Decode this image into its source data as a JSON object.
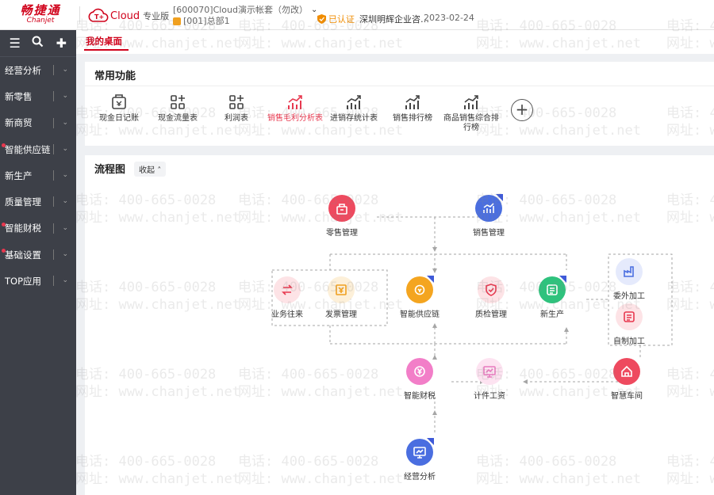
{
  "header": {
    "logo_cn": "畅捷通",
    "logo_en": "Chanjet",
    "product": "Cloud",
    "edition": "专业版",
    "account": "[600070]Cloud演示帐套（勿改）",
    "department": "[001]总部1",
    "certified_label": "已认证",
    "company": "深圳明辉企业咨…",
    "date": "2023-02-24"
  },
  "sidebar": {
    "tools": [
      "menu-icon",
      "search-icon",
      "plus-icon"
    ],
    "items": [
      {
        "label": "经营分析",
        "dot": false
      },
      {
        "label": "新零售",
        "dot": false
      },
      {
        "label": "新商贸",
        "dot": false
      },
      {
        "label": "智能供应链",
        "dot": true
      },
      {
        "label": "新生产",
        "dot": false
      },
      {
        "label": "质量管理",
        "dot": false
      },
      {
        "label": "智能财税",
        "dot": true
      },
      {
        "label": "基础设置",
        "dot": true
      },
      {
        "label": "TOP应用",
        "dot": false
      }
    ]
  },
  "tabs": {
    "active": "我的桌面"
  },
  "common": {
    "title": "常用功能",
    "items": [
      {
        "label": "现金日记账",
        "icon": "cash-journal-icon"
      },
      {
        "label": "现金流量表",
        "icon": "grid-plus-icon"
      },
      {
        "label": "利润表",
        "icon": "grid-plus-icon"
      },
      {
        "label": "销售毛利分析表",
        "icon": "chart-up-icon",
        "active": true
      },
      {
        "label": "进销存统计表",
        "icon": "chart-up-icon"
      },
      {
        "label": "销售排行榜",
        "icon": "chart-up-icon"
      },
      {
        "label": "商品销售综合排行榜",
        "icon": "chart-up-icon"
      }
    ]
  },
  "flow": {
    "title": "流程图",
    "collapse_label": "收起",
    "nodes": {
      "retail": "零售管理",
      "sales": "销售管理",
      "contacts": "业务往来",
      "invoice": "发票管理",
      "supply": "智能供应链",
      "quality": "质检管理",
      "production": "新生产",
      "outsource": "委外加工",
      "selfmade": "自制加工",
      "finance": "智能财税",
      "piecework": "计件工资",
      "workshop": "智慧车间",
      "analysis": "经营分析"
    }
  },
  "watermark": {
    "phone": "电话: 400-665-0028",
    "site": "网址: www.chanjet.net"
  },
  "colors": {
    "brand": "#d0021b",
    "accent_red": "#e8384f",
    "blue": "#4a6ee0",
    "orange": "#f0a020",
    "green": "#2fc27d",
    "sidebar": "#3d4048"
  }
}
